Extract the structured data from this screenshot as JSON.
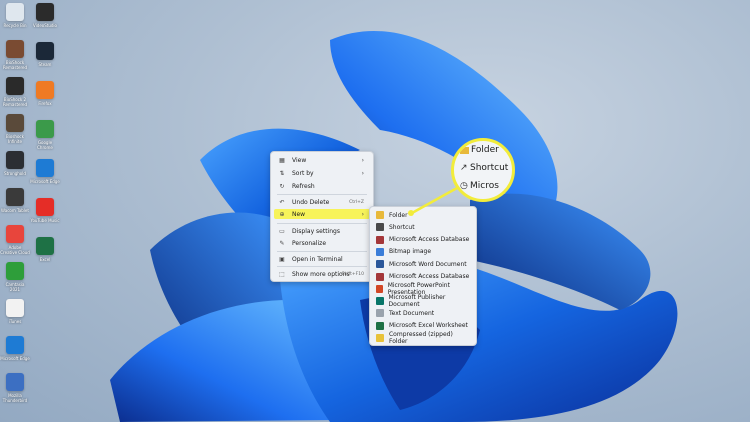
{
  "desktop": {
    "left_column": [
      {
        "label": "Recycle Bin",
        "icon": "recycle-bin-icon",
        "color": "#dfe7ee"
      },
      {
        "label": "BioShock Remastered",
        "icon": "bioshock-icon",
        "color": "#7a4b32"
      },
      {
        "label": "BioShock 2 Remastered",
        "icon": "bioshock2-icon",
        "color": "#2a2a2a"
      },
      {
        "label": "Bioshock Infinite",
        "icon": "bioshock-infinite-icon",
        "color": "#5a4a3a"
      },
      {
        "label": "Stronghold",
        "icon": "stronghold-icon",
        "color": "#2b2e33"
      },
      {
        "label": "Wacom Tablet",
        "icon": "wacom-icon",
        "color": "#3a3a3a"
      },
      {
        "label": "Adobe Creative Cloud",
        "icon": "creative-cloud-icon",
        "color": "#e8453c"
      },
      {
        "label": "Camtasia 2021",
        "icon": "camtasia-icon",
        "color": "#2e9e3a"
      },
      {
        "label": "iTunes",
        "icon": "itunes-icon",
        "color": "#f2f2f2"
      },
      {
        "label": "Microsoft Edge",
        "icon": "edge-icon",
        "color": "#1e7bd4"
      },
      {
        "label": "Mozilla Thunderbird",
        "icon": "thunderbird-icon",
        "color": "#3c6fc2"
      }
    ],
    "right_column": [
      {
        "label": "VideoStudio",
        "icon": "videostudio-icon",
        "color": "#2b2b2b"
      },
      {
        "label": "Steam",
        "icon": "steam-icon",
        "color": "#1b2838"
      },
      {
        "label": "Firefox",
        "icon": "firefox-icon",
        "color": "#ef7a23"
      },
      {
        "label": "Google Chrome",
        "icon": "chrome-icon",
        "color": "#3b9a4a"
      },
      {
        "label": "Microsoft Edge",
        "icon": "edge-icon",
        "color": "#1e7bd4"
      },
      {
        "label": "YouTube Music",
        "icon": "youtube-music-icon",
        "color": "#e52d27"
      },
      {
        "label": "Excel",
        "icon": "excel-icon",
        "color": "#1e7145"
      }
    ]
  },
  "context_menu": {
    "items": [
      {
        "icon": "grid-icon",
        "glyph": "▦",
        "label": "View",
        "shortcut": "",
        "has_submenu": true
      },
      {
        "icon": "sort-icon",
        "glyph": "⇅",
        "label": "Sort by",
        "shortcut": "",
        "has_submenu": true
      },
      {
        "icon": "refresh-icon",
        "glyph": "↻",
        "label": "Refresh",
        "shortcut": "",
        "has_submenu": false
      },
      {
        "icon": "undo-icon",
        "glyph": "↶",
        "label": "Undo Delete",
        "shortcut": "Ctrl+Z",
        "has_submenu": false
      },
      {
        "icon": "new-icon",
        "glyph": "⊕",
        "label": "New",
        "shortcut": "",
        "has_submenu": true
      },
      {
        "icon": "display-icon",
        "glyph": "▭",
        "label": "Display settings",
        "shortcut": "",
        "has_submenu": false
      },
      {
        "icon": "personalize-icon",
        "glyph": "✎",
        "label": "Personalize",
        "shortcut": "",
        "has_submenu": false
      },
      {
        "icon": "terminal-icon",
        "glyph": "▣",
        "label": "Open in Terminal",
        "shortcut": "",
        "has_submenu": false
      },
      {
        "icon": "more-options-icon",
        "glyph": "⬚",
        "label": "Show more options",
        "shortcut": "Shift+F10",
        "has_submenu": false
      }
    ],
    "highlight_color": "#f7f35a"
  },
  "new_submenu": {
    "items": [
      {
        "icon": "folder-icon",
        "color": "#e8b93a",
        "label": "Folder"
      },
      {
        "icon": "shortcut-icon",
        "color": "#4a4a4a",
        "label": "Shortcut"
      },
      {
        "icon": "access-icon",
        "color": "#a4373a",
        "label": "Microsoft Access Database"
      },
      {
        "icon": "bitmap-icon",
        "color": "#3b7dd8",
        "label": "Bitmap image"
      },
      {
        "icon": "word-icon",
        "color": "#2b579a",
        "label": "Microsoft Word Document"
      },
      {
        "icon": "access-icon",
        "color": "#a4373a",
        "label": "Microsoft Access Database"
      },
      {
        "icon": "powerpoint-icon",
        "color": "#d24726",
        "label": "Microsoft PowerPoint Presentation"
      },
      {
        "icon": "publisher-icon",
        "color": "#077568",
        "label": "Microsoft Publisher Document"
      },
      {
        "icon": "text-icon",
        "color": "#9aa3ad",
        "label": "Text Document"
      },
      {
        "icon": "excel-icon",
        "color": "#1e7145",
        "label": "Microsoft Excel Worksheet"
      },
      {
        "icon": "zip-icon",
        "color": "#e8c23a",
        "label": "Compressed (zipped) Folder"
      }
    ]
  },
  "magnifier": {
    "rows": [
      {
        "icon": "folder-icon",
        "glyph": "",
        "label": "Folder"
      },
      {
        "icon": "shortcut-icon",
        "glyph": "↗",
        "label": "Shortcut"
      },
      {
        "icon": "access-icon",
        "glyph": "◷",
        "label": "Micros"
      }
    ],
    "ring_color": "#f2ec3b"
  }
}
